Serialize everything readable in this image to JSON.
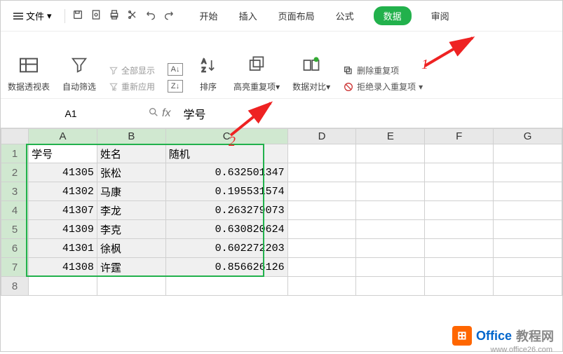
{
  "menu": {
    "file_label": "文件",
    "tabs": [
      "开始",
      "插入",
      "页面布局",
      "公式",
      "数据",
      "审阅"
    ],
    "active_tab_index": 4
  },
  "ribbon": {
    "pivot": "数据透视表",
    "autofilter": "自动筛选",
    "show_all": "全部显示",
    "reapply": "重新应用",
    "sort_asc": "A↓Z",
    "sort_desc": "Z↓A",
    "sort": "排序",
    "highlight_dup": "高亮重复项",
    "data_compare": "数据对比",
    "remove_dup": "删除重复项",
    "reject_dup": "拒绝录入重复项"
  },
  "annotations": {
    "label1": "1",
    "label2": "2"
  },
  "formula_bar": {
    "name_box": "A1",
    "formula_value": "学号"
  },
  "grid": {
    "columns": [
      "A",
      "B",
      "C",
      "D",
      "E",
      "F",
      "G"
    ],
    "selected_cols": [
      "A",
      "B",
      "C"
    ],
    "row_count": 8,
    "selected_rows": [
      1,
      2,
      3,
      4,
      5,
      6,
      7
    ],
    "headers": {
      "A": "学号",
      "B": "姓名",
      "C": "随机"
    },
    "data": [
      {
        "A": "41305",
        "B": "张松",
        "C": "0.632501347"
      },
      {
        "A": "41302",
        "B": "马康",
        "C": "0.195531574"
      },
      {
        "A": "41307",
        "B": "李龙",
        "C": "0.263279073"
      },
      {
        "A": "41309",
        "B": "李克",
        "C": "0.630820624"
      },
      {
        "A": "41301",
        "B": "徐枫",
        "C": "0.602272203"
      },
      {
        "A": "41308",
        "B": "许霆",
        "C": "0.856626126"
      }
    ]
  },
  "watermark": {
    "brand1": "Office",
    "brand2": "教程网",
    "url": "www.office26.com"
  }
}
